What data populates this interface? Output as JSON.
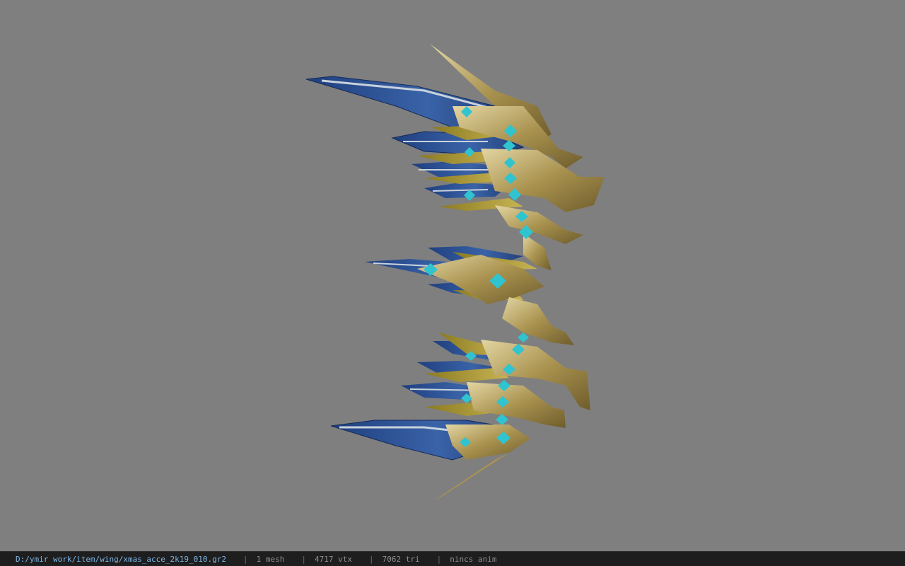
{
  "viewer": {
    "background_color": "#7f7f7f",
    "model": {
      "name": "xmas_acce_2k19_010",
      "feather_blue": "#2d4f8f",
      "feather_edge": "#c8d2dc",
      "gold": "#b8a26a",
      "gem": "#2fc4cf"
    }
  },
  "status": {
    "path": "D:/ymir work/item/wing/xmas_acce_2k19_010.gr2",
    "separator": "|",
    "mesh": "1 mesh",
    "vertices": "4717 vtx",
    "triangles": "7062 tri",
    "animation": "nincs anim"
  }
}
